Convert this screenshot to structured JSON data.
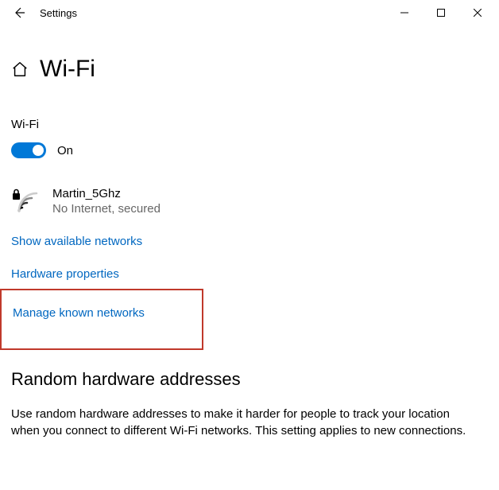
{
  "titlebar": {
    "title": "Settings"
  },
  "page": {
    "title": "Wi-Fi"
  },
  "wifi": {
    "label": "Wi-Fi",
    "toggle_state": "On",
    "network_name": "Martin_5Ghz",
    "network_status": "No Internet, secured"
  },
  "links": {
    "show_available": "Show available networks",
    "hardware_props": "Hardware properties",
    "manage_known": "Manage known networks"
  },
  "random_hw": {
    "heading": "Random hardware addresses",
    "body": "Use random hardware addresses to make it harder for people to track your location when you connect to different Wi-Fi networks. This setting applies to new connections."
  }
}
